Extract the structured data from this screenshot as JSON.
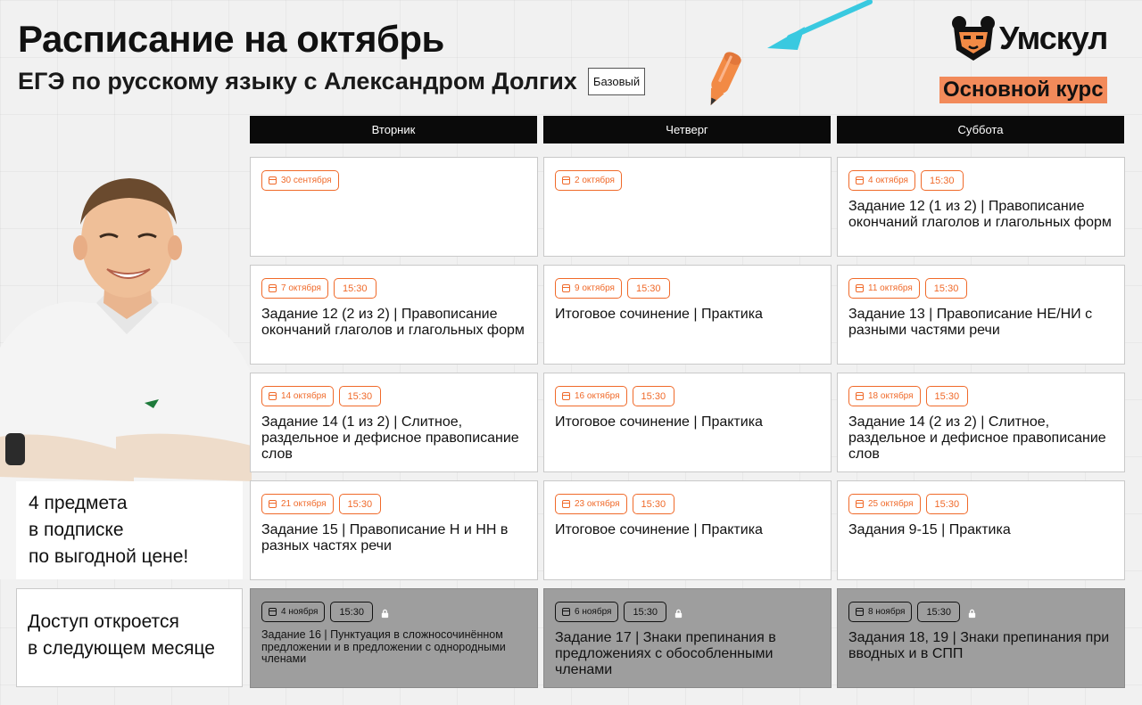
{
  "title": "Расписание на октябрь",
  "subtitle": "ЕГЭ по русскому языку с Александром Долгих",
  "level": "Базовый",
  "brand": {
    "name": "Умскул",
    "course": "Основной курс",
    "accent": "#f28a5a"
  },
  "days": [
    "Вторник",
    "Четверг",
    "Суббота"
  ],
  "promo": {
    "line1": "4 предмета",
    "line2": "в подписке",
    "line3": "по выгодной цене!"
  },
  "access": {
    "line1": "Доступ откроется",
    "line2": "в следующем месяце"
  },
  "rows": [
    [
      {
        "date": "30 сентября",
        "time": "",
        "topic": ""
      },
      {
        "date": "2 октября",
        "time": "",
        "topic": ""
      },
      {
        "date": "4 октября",
        "time": "15:30",
        "topic": "Задание 12 (1 из 2) | Правописание окончаний глаголов и глагольных форм"
      }
    ],
    [
      {
        "date": "7 октября",
        "time": "15:30",
        "topic": "Задание 12 (2 из 2) | Правописание окончаний глаголов и глагольных форм"
      },
      {
        "date": "9 октября",
        "time": "15:30",
        "topic": "Итоговое сочинение | Практика"
      },
      {
        "date": "11 октября",
        "time": "15:30",
        "topic": "Задание 13 | Правописание НЕ/НИ с разными частями речи"
      }
    ],
    [
      {
        "date": "14 октября",
        "time": "15:30",
        "topic": "Задание 14 (1 из 2) | Слитное, раздельное и дефисное правописание слов"
      },
      {
        "date": "16 октября",
        "time": "15:30",
        "topic": "Итоговое сочинение | Практика"
      },
      {
        "date": "18 октября",
        "time": "15:30",
        "topic": "Задание 14 (2 из 2) | Слитное, раздельное и дефисное правописание слов"
      }
    ],
    [
      {
        "date": "21 октября",
        "time": "15:30",
        "topic": "Задание 15 | Правописание Н и НН в разных частях речи"
      },
      {
        "date": "23 октября",
        "time": "15:30",
        "topic": "Итоговое сочинение | Практика"
      },
      {
        "date": "25 октября",
        "time": "15:30",
        "topic": "Задания 9-15 | Практика"
      }
    ],
    [
      {
        "date": "4 ноября",
        "time": "15:30",
        "topic": "Задание 16 | Пунктуация в сложносочинённом предложении и в предложении с однородными членами",
        "locked": true
      },
      {
        "date": "6 ноября",
        "time": "15:30",
        "topic": "Задание 17 | Знаки препинания в предложениях с обособленными членами",
        "locked": true
      },
      {
        "date": "8 ноября",
        "time": "15:30",
        "topic": "Задания 18, 19 | Знаки препинания при вводных и в СПП",
        "locked": true
      }
    ]
  ]
}
